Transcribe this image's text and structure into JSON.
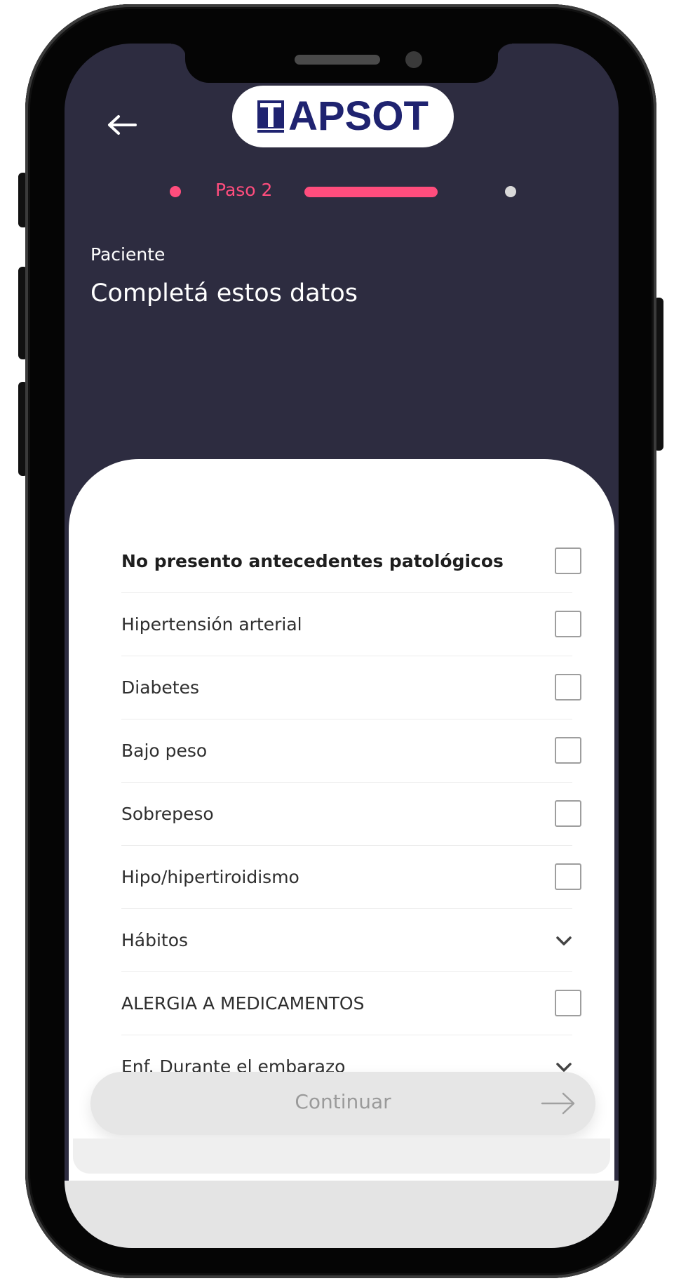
{
  "header": {
    "back_icon": "arrow-left-icon",
    "logo_text": "APSOT"
  },
  "stepper": {
    "current_step_label": "Paso 2"
  },
  "form": {
    "section_label": "Paciente",
    "title": "Completá estos datos"
  },
  "options": [
    {
      "label": "No presento antecedentes patológicos",
      "control": "checkbox",
      "checked": false
    },
    {
      "label": "Hipertensión arterial",
      "control": "checkbox",
      "checked": false
    },
    {
      "label": "Diabetes",
      "control": "checkbox",
      "checked": false
    },
    {
      "label": "Bajo peso",
      "control": "checkbox",
      "checked": false
    },
    {
      "label": "Sobrepeso",
      "control": "checkbox",
      "checked": false
    },
    {
      "label": "Hipo/hipertiroidismo",
      "control": "checkbox",
      "checked": false
    },
    {
      "label": "Hábitos",
      "control": "dropdown",
      "icon": "chevron-down-icon"
    },
    {
      "label": "ALERGIA A MEDICAMENTOS",
      "control": "checkbox",
      "checked": false
    },
    {
      "label": "Enf. Durante el embarazo",
      "control": "dropdown",
      "icon": "chevron-down-icon"
    }
  ],
  "footer": {
    "continue_label": "Continuar",
    "continue_icon": "arrow-right-icon",
    "continue_enabled": false
  },
  "colors": {
    "header_bg": "#2d2c40",
    "accent": "#ff4d7d",
    "logo_blue": "#1f2370",
    "button_disabled_bg": "#e6e6e6"
  }
}
